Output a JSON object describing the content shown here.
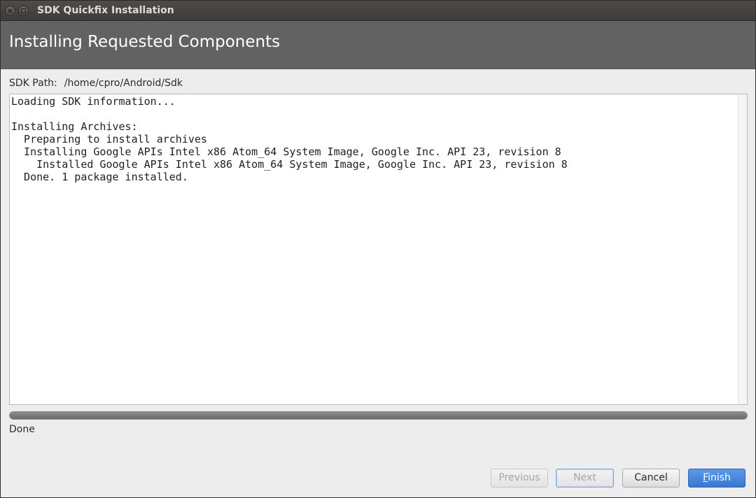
{
  "window": {
    "title": "SDK Quickfix Installation",
    "close_glyph": "×"
  },
  "header": {
    "title": "Installing Requested Components"
  },
  "sdk_path": {
    "label": "SDK Path:",
    "value": "/home/cpro/Android/Sdk"
  },
  "log": {
    "text": "Loading SDK information...\n\nInstalling Archives:\n  Preparing to install archives\n  Installing Google APIs Intel x86 Atom_64 System Image, Google Inc. API 23, revision 8\n    Installed Google APIs Intel x86 Atom_64 System Image, Google Inc. API 23, revision 8\n  Done. 1 package installed."
  },
  "progress": {
    "fraction": 1.0
  },
  "status": {
    "text": "Done"
  },
  "buttons": {
    "previous": "Previous",
    "next": "Next",
    "cancel": "Cancel",
    "finish_mnemonic": "F",
    "finish_rest": "inish"
  },
  "colors": {
    "header_bg": "#626262",
    "finish_accent": "#3a78d0"
  },
  "icons": [
    "close-icon",
    "maximize-icon"
  ]
}
